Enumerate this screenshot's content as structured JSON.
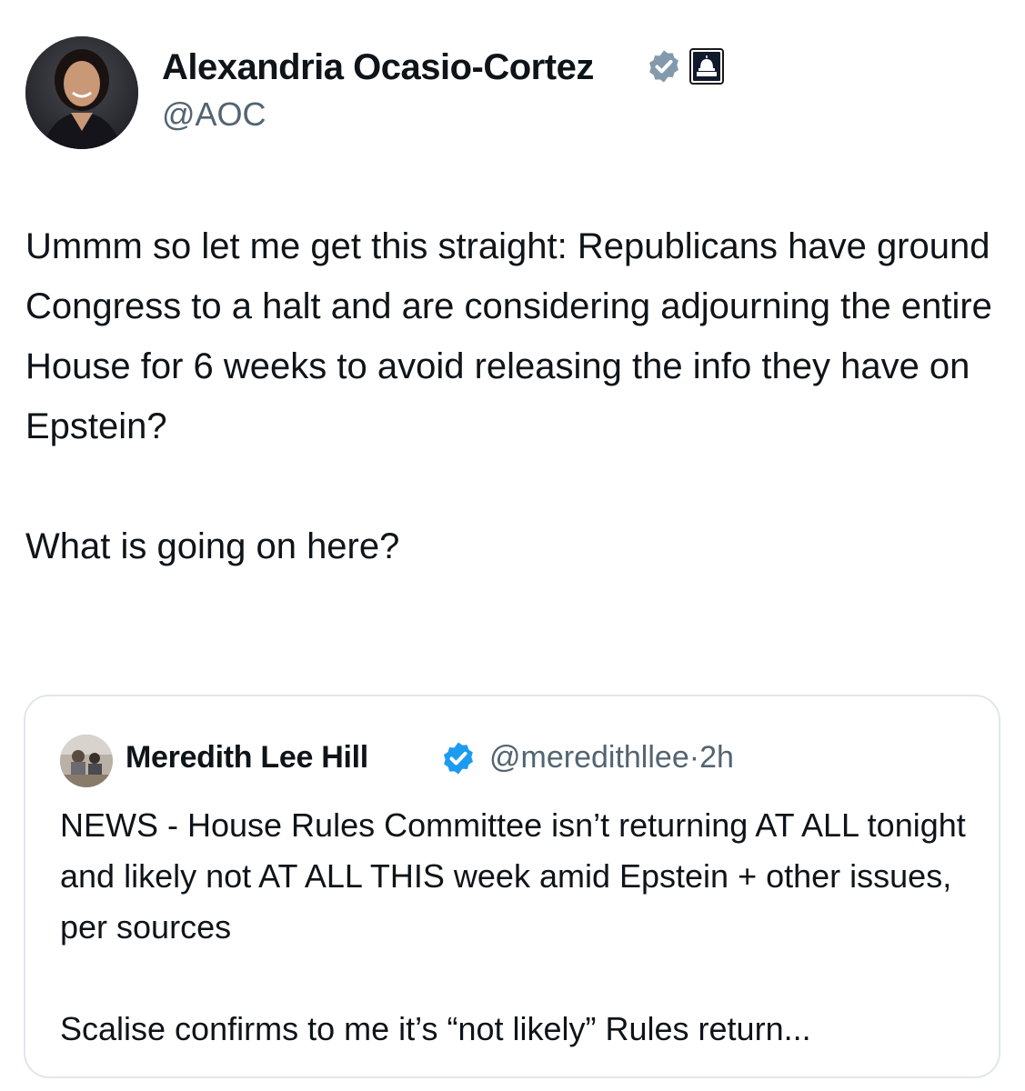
{
  "author": {
    "display_name": "Alexandria Ocasio-Cortez",
    "handle": "@AOC",
    "verified_badge_color": "#829aab",
    "affiliation_icon": "capitol-dome-icon"
  },
  "post": {
    "paragraphs": [
      "Ummm so let me get this straight: Republicans have ground Congress to a halt and are considering adjourning the entire House for 6 weeks to avoid releasing the info they have on Epstein?",
      "What is going on here?"
    ]
  },
  "quoted_post": {
    "display_name": "Meredith Lee Hill",
    "handle": "@meredithllee",
    "separator": "·",
    "time": "2h",
    "verified_badge_color": "#1d9bf0",
    "paragraphs": [
      "NEWS - House Rules Committee isn’t returning AT ALL tonight and likely not AT ALL THIS week amid Epstein + other issues, per sources",
      "Scalise confirms to me it’s “not likely” Rules return..."
    ]
  }
}
